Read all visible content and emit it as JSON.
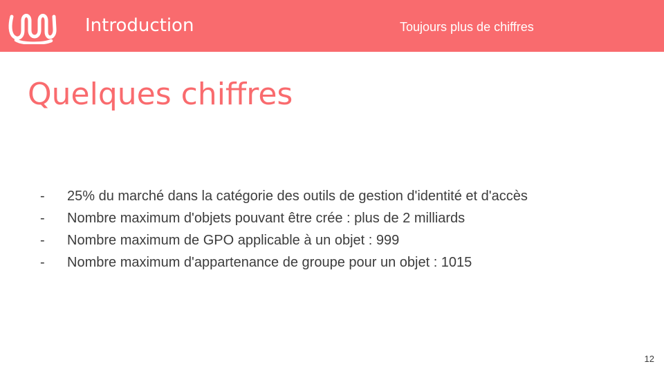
{
  "header": {
    "section_title": "Introduction",
    "subtitle": "Toujours plus de chiffres",
    "logo_icon": "wavy-squiggle-logo-icon",
    "background_color": "#f96b6e",
    "text_color": "#ffffff"
  },
  "main": {
    "title": "Quelques chiffres",
    "title_color": "#f96b6e",
    "bullet_marker": "-",
    "bullets": [
      "25% du marché dans la catégorie des outils de gestion d'identité et d'accès",
      "Nombre maximum d'objets pouvant être crée : plus de 2 milliards",
      "Nombre maximum de GPO applicable à un objet : 999",
      "Nombre maximum d'appartenance de groupe pour un objet : 1015"
    ]
  },
  "footer": {
    "page_number": "12"
  }
}
